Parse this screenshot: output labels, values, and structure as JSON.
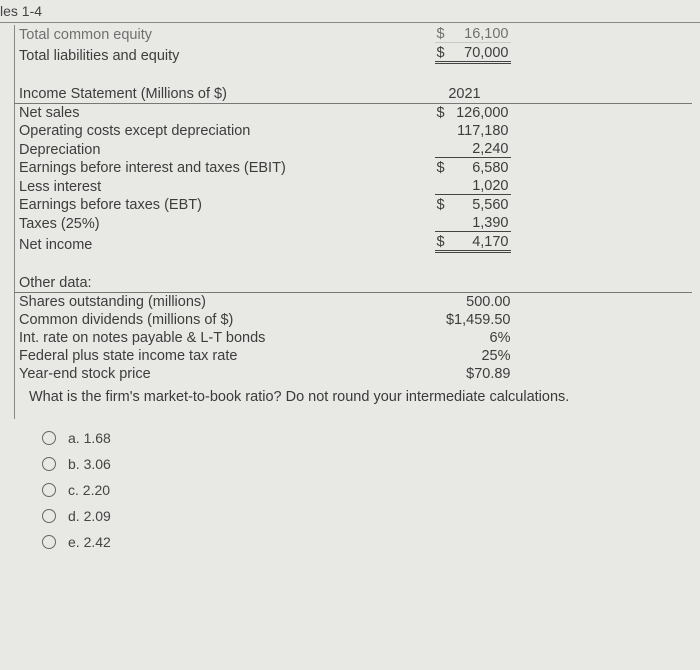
{
  "page_header": "les 1-4",
  "equity_section": {
    "rows": [
      {
        "label": "Total common equity",
        "dollar": "$",
        "value": "16,100",
        "faded": true
      },
      {
        "label": "Total liabilities and equity",
        "dollar": "$",
        "value": "70,000",
        "double": true
      }
    ]
  },
  "income_statement": {
    "header_label": "Income Statement (Millions of $)",
    "header_year": "2021",
    "rows": [
      {
        "label": "Net sales",
        "dollar": "$",
        "value": "126,000"
      },
      {
        "label": "Operating costs except depreciation",
        "dollar": "",
        "value": "117,180"
      },
      {
        "label": "Depreciation",
        "dollar": "",
        "value": "2,240",
        "single": true
      },
      {
        "label": "Earnings before interest and taxes (EBIT)",
        "dollar": "$",
        "value": "6,580"
      },
      {
        "label": "Less interest",
        "dollar": "",
        "value": "1,020",
        "single": true
      },
      {
        "label": "Earnings before taxes (EBT)",
        "dollar": "$",
        "value": "5,560"
      },
      {
        "label": "Taxes (25%)",
        "dollar": "",
        "value": "1,390",
        "single": true
      },
      {
        "label": "Net income",
        "dollar": "$",
        "value": "4,170",
        "double": true
      }
    ]
  },
  "other_data": {
    "header": "Other data:",
    "rows": [
      {
        "label": "Shares outstanding (millions)",
        "value": "500.00"
      },
      {
        "label": "Common dividends (millions of $)",
        "value": "$1,459.50"
      },
      {
        "label": "Int. rate on notes payable & L-T bonds",
        "value": "6%"
      },
      {
        "label": "Federal plus state income tax rate",
        "value": "25%"
      },
      {
        "label": "Year-end stock price",
        "value": "$70.89"
      }
    ]
  },
  "question": "What is the firm's market-to-book ratio? Do not round your intermediate calculations.",
  "options": [
    {
      "key": "a",
      "text": "a. 1.68"
    },
    {
      "key": "b",
      "text": "b. 3.06"
    },
    {
      "key": "c",
      "text": "c. 2.20"
    },
    {
      "key": "d",
      "text": "d. 2.09"
    },
    {
      "key": "e",
      "text": "e. 2.42"
    }
  ]
}
